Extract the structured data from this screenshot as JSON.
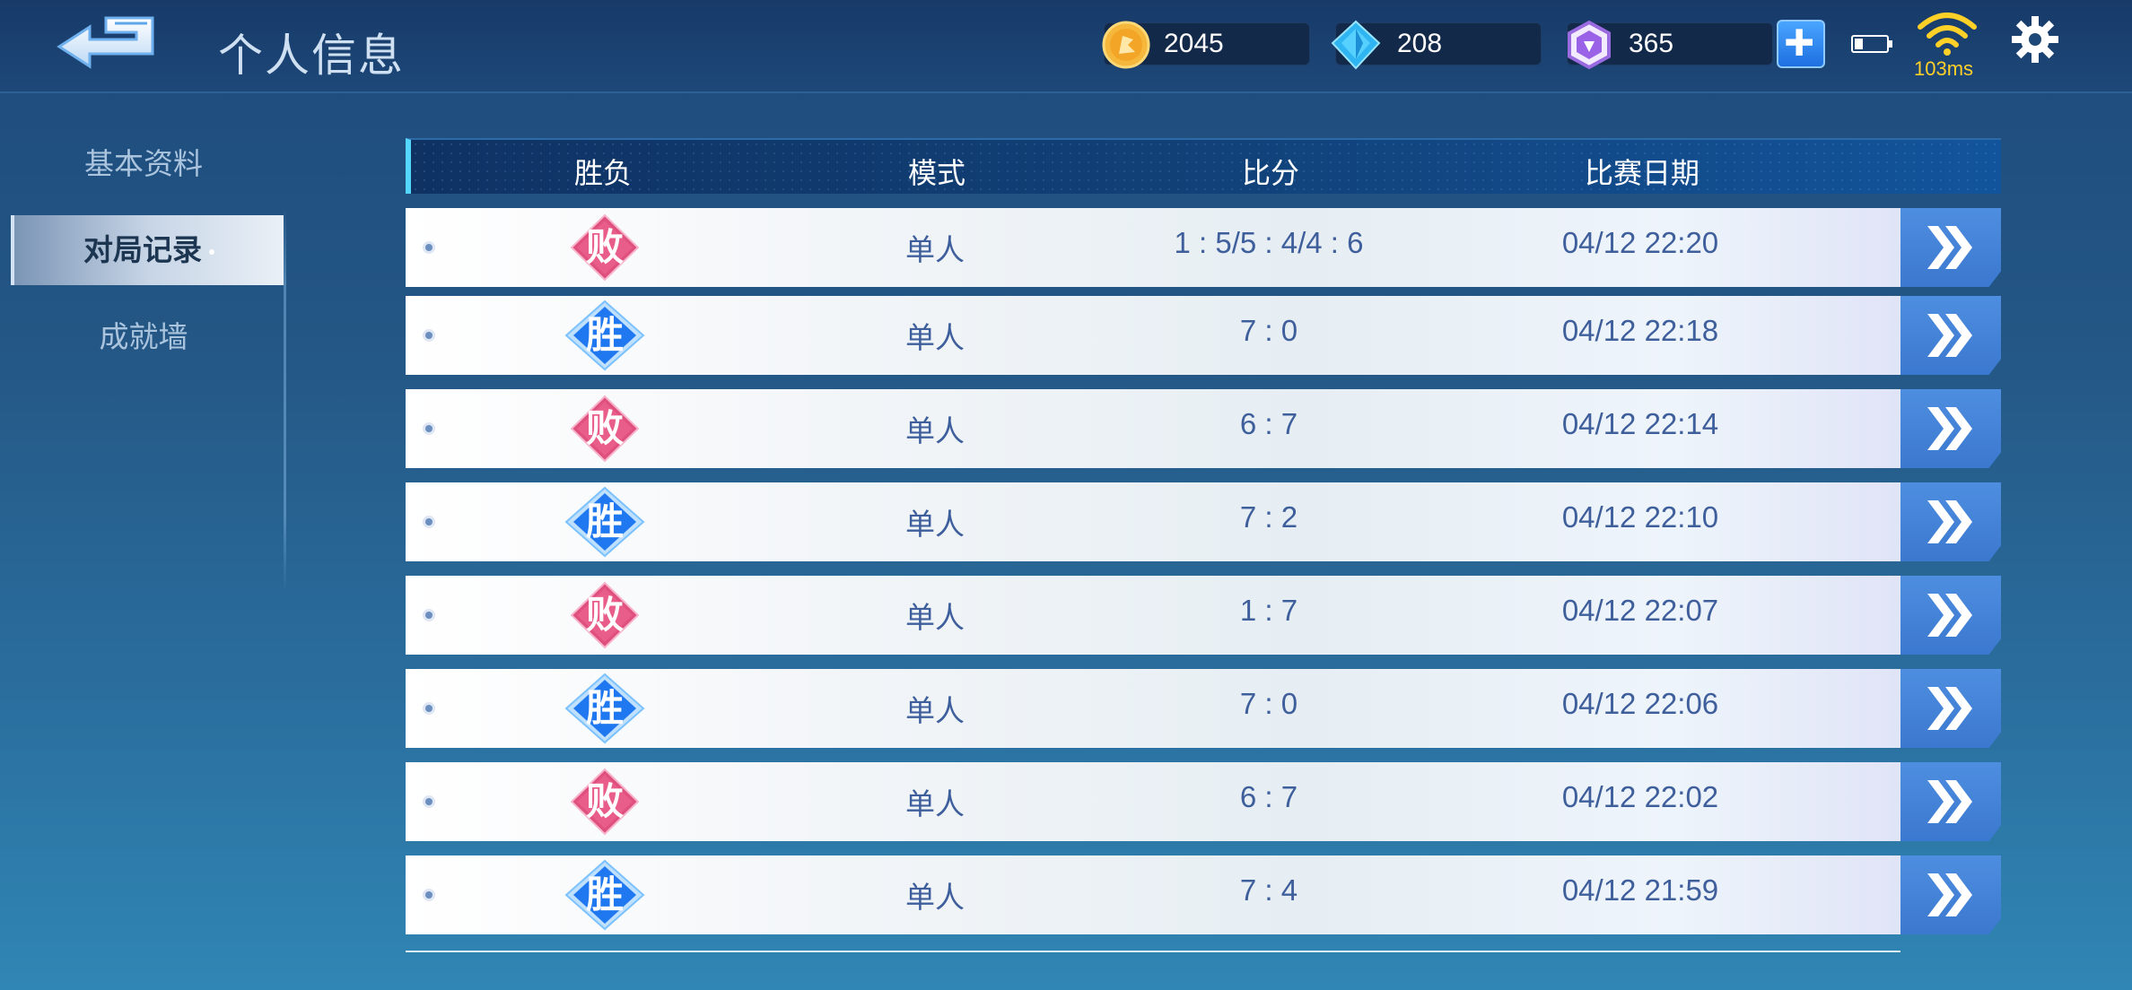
{
  "header": {
    "title": "个人信息",
    "gold": "2045",
    "diamond": "208",
    "gem": "365",
    "ping": "103ms"
  },
  "sidebar": {
    "items": [
      {
        "label": "基本资料"
      },
      {
        "label": "对局记录"
      },
      {
        "label": "成就墙"
      }
    ]
  },
  "table": {
    "columns": [
      "胜负",
      "模式",
      "比分",
      "比赛日期"
    ],
    "rows": [
      {
        "result": "败",
        "mode": "单人",
        "score": "1 : 5/5 : 4/4 : 6",
        "date": "04/12 22:20"
      },
      {
        "result": "胜",
        "mode": "单人",
        "score": "7 : 0",
        "date": "04/12 22:18"
      },
      {
        "result": "败",
        "mode": "单人",
        "score": "6 : 7",
        "date": "04/12 22:14"
      },
      {
        "result": "胜",
        "mode": "单人",
        "score": "7 : 2",
        "date": "04/12 22:10"
      },
      {
        "result": "败",
        "mode": "单人",
        "score": "1 : 7",
        "date": "04/12 22:07"
      },
      {
        "result": "胜",
        "mode": "单人",
        "score": "7 : 0",
        "date": "04/12 22:06"
      },
      {
        "result": "败",
        "mode": "单人",
        "score": "6 : 7",
        "date": "04/12 22:02"
      },
      {
        "result": "胜",
        "mode": "单人",
        "score": "7 : 4",
        "date": "04/12 21:59"
      }
    ]
  },
  "colors": {
    "win": "#1f78f0",
    "loss": "#e0507e",
    "accent": "#54d6ff",
    "row_text": "#3e5f9c"
  }
}
